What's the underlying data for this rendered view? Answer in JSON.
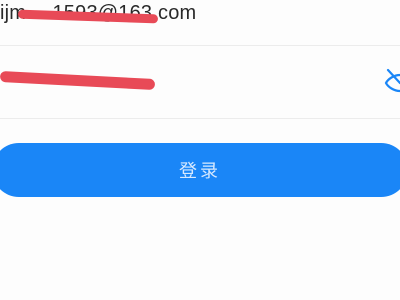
{
  "login_form": {
    "email_value": "ijm··· 1593@163.com",
    "password_value": "",
    "password_visibility_icon": "eye-slash-icon",
    "submit_label": "登录"
  },
  "colors": {
    "accent": "#1a86f7",
    "button_text": "#d6e9ff",
    "redaction": "#e84a57",
    "divider": "#ececec"
  }
}
